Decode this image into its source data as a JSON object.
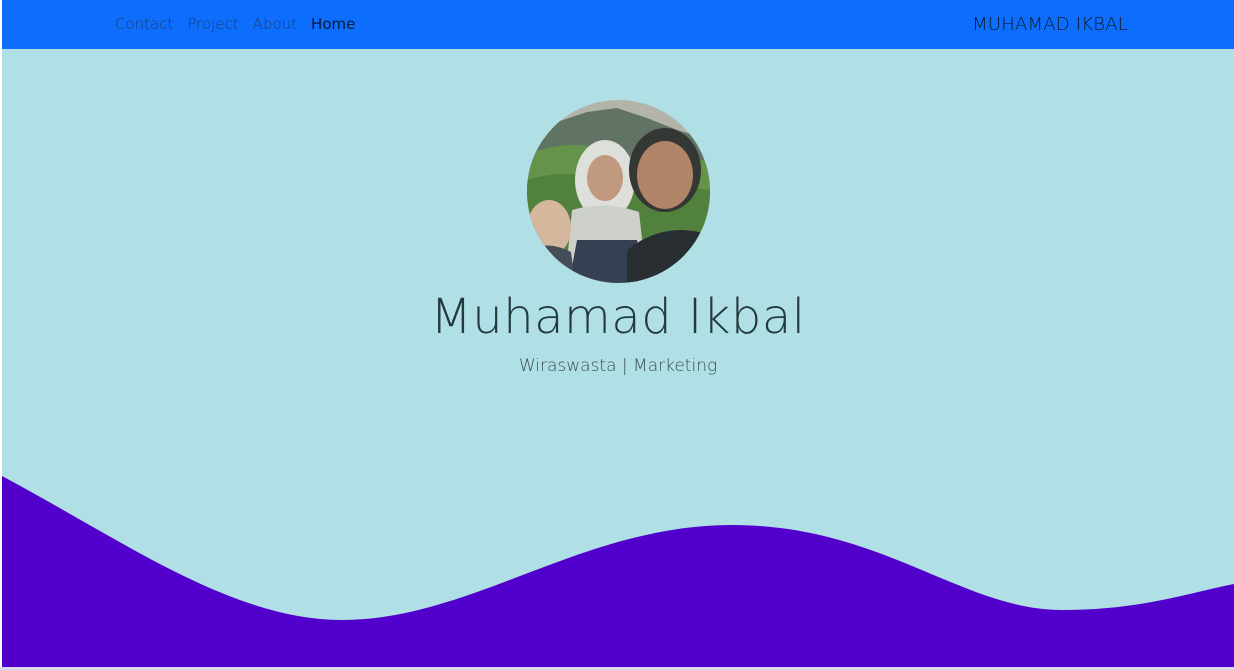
{
  "navbar": {
    "links": [
      {
        "label": "Contact"
      },
      {
        "label": "Project"
      },
      {
        "label": "About"
      },
      {
        "label": "Home"
      }
    ],
    "brand": "MUHAMAD IKBAL"
  },
  "hero": {
    "name": "Muhamad Ikbal",
    "subtitle": "Wiraswasta | Marketing"
  },
  "colors": {
    "navbar": "#0d6efd",
    "background": "#b0dfe5",
    "wave": "#5200cc"
  }
}
